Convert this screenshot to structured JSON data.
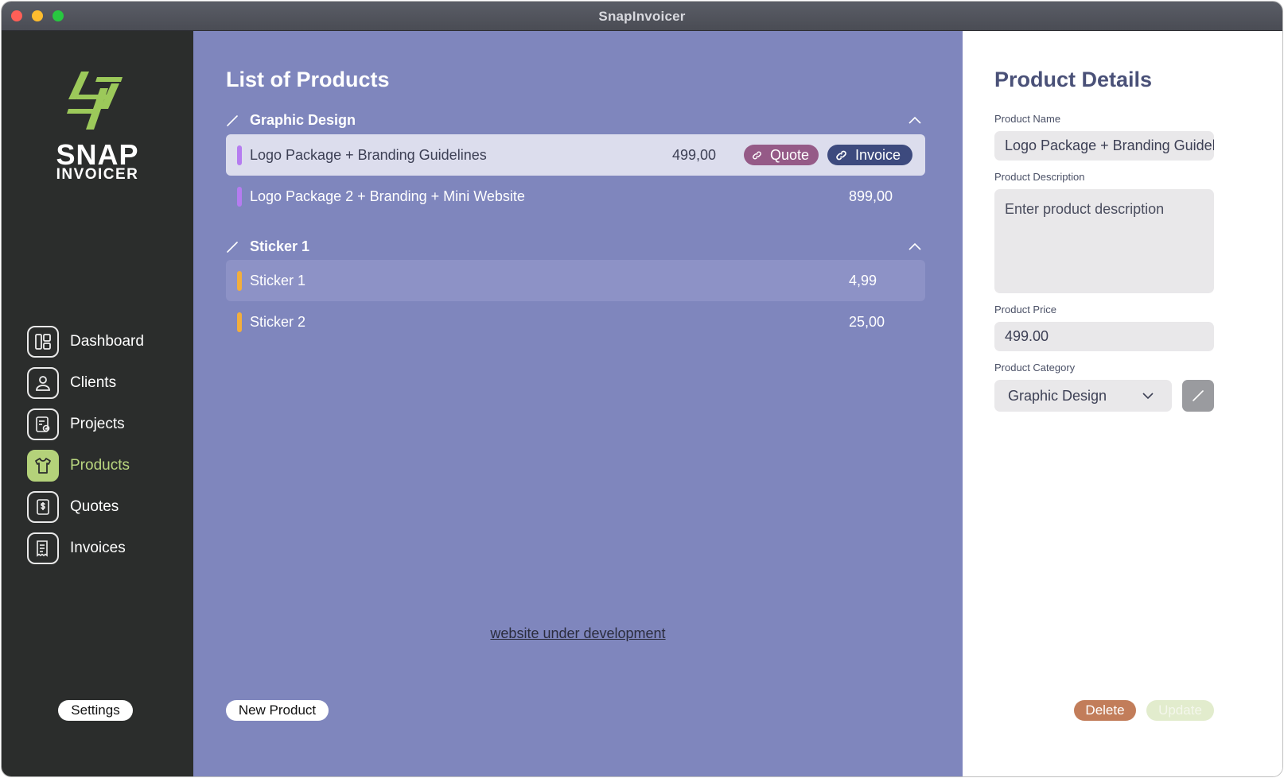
{
  "window": {
    "title": "SnapInvoicer"
  },
  "brand": {
    "line1": "SNAP",
    "line2": "INVOICER",
    "accent": "#b4d27a"
  },
  "sidebar": {
    "items": [
      {
        "label": "Dashboard",
        "icon": "dashboard-icon"
      },
      {
        "label": "Clients",
        "icon": "user-icon"
      },
      {
        "label": "Projects",
        "icon": "projects-icon"
      },
      {
        "label": "Products",
        "icon": "tshirt-icon",
        "active": true
      },
      {
        "label": "Quotes",
        "icon": "dollar-document-icon"
      },
      {
        "label": "Invoices",
        "icon": "receipt-icon"
      }
    ],
    "settings_label": "Settings"
  },
  "main": {
    "title": "List of Products",
    "categories": [
      {
        "name": "Graphic Design",
        "color": "#b57cf0",
        "products": [
          {
            "name": "Logo Package + Branding Guidelines",
            "price": "499,00",
            "quote_label": "Quote",
            "invoice_label": "Invoice"
          },
          {
            "name": "Logo Package 2 + Branding + Mini Website",
            "price": "899,00"
          }
        ]
      },
      {
        "name": "Sticker 1",
        "color": "#f2ae3d",
        "products": [
          {
            "name": "Sticker 1",
            "price": "4,99"
          },
          {
            "name": "Sticker 2",
            "price": "25,00"
          }
        ]
      }
    ],
    "dev_link": "website under development",
    "new_product_label": "New Product"
  },
  "details": {
    "title": "Product Details",
    "name_label": "Product Name",
    "name_value": "Logo Package + Branding Guidelines",
    "description_label": "Product Description",
    "description_placeholder": "Enter product description",
    "price_label": "Product Price",
    "price_value": "499.00",
    "category_label": "Product Category",
    "category_value": "Graphic Design",
    "delete_label": "Delete",
    "update_label": "Update"
  }
}
